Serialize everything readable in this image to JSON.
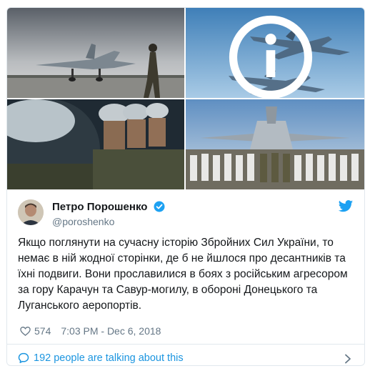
{
  "tweet": {
    "author_name": "Петро Порошенко",
    "author_handle": "@poroshenko",
    "text": "Якщо поглянути на сучасну історію Збройних Сил України, то немає в ній жодної сторінки, де б не йшлося про десантників та їхні подвиги. Вони прославилися в боях з російським агресором за гору Карачун та Савур-могилу, в обороні Донецького та Луганського аеропортів.",
    "likes": "574",
    "timestamp": "7:03 PM - Dec 6, 2018",
    "talking_label": "192 people are talking about this"
  },
  "icons": {
    "info": "info-icon",
    "verified": "verified-badge-icon",
    "brand": "twitter-bird-icon",
    "like": "heart-icon",
    "talking": "speech-bubble-icon",
    "chevron": "chevron-right-icon"
  },
  "colors": {
    "link": "#1b95e0",
    "muted": "#657786",
    "text": "#14171a",
    "brand": "#1da1f2"
  }
}
